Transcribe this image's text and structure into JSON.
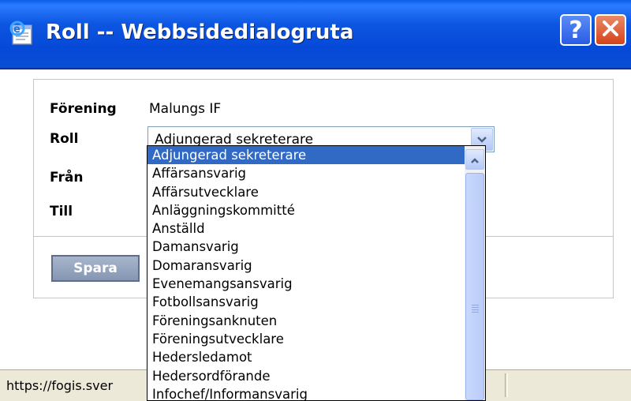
{
  "window": {
    "title": "Roll -- Webbsidedialogruta",
    "help_label": "?",
    "close_icon": "close-icon"
  },
  "form": {
    "forening_label": "Förening",
    "forening_value": "Malungs IF",
    "roll_label": "Roll",
    "roll_value": "Adjungerad sekreterare",
    "fran_label": "Från",
    "till_label": "Till",
    "save_label": "Spara"
  },
  "dropdown": {
    "selected_index": 0,
    "options": [
      "Adjungerad sekreterare",
      "Affärsansvarig",
      "Affärsutvecklare",
      "Anläggningskommitté",
      "Anställd",
      "Damansvarig",
      "Domaransvarig",
      "Evenemangsansvarig",
      "Fotbollsansvarig",
      "Föreningsanknuten",
      "Föreningsutvecklare",
      "Hedersledamot",
      "Hedersordförande",
      "Infochef/Informansvarig"
    ]
  },
  "status": {
    "url": "https://fogis.sver"
  },
  "colors": {
    "titlebar": "#0D56E1",
    "selection": "#316AC5",
    "chrome": "#ECE9D8"
  }
}
